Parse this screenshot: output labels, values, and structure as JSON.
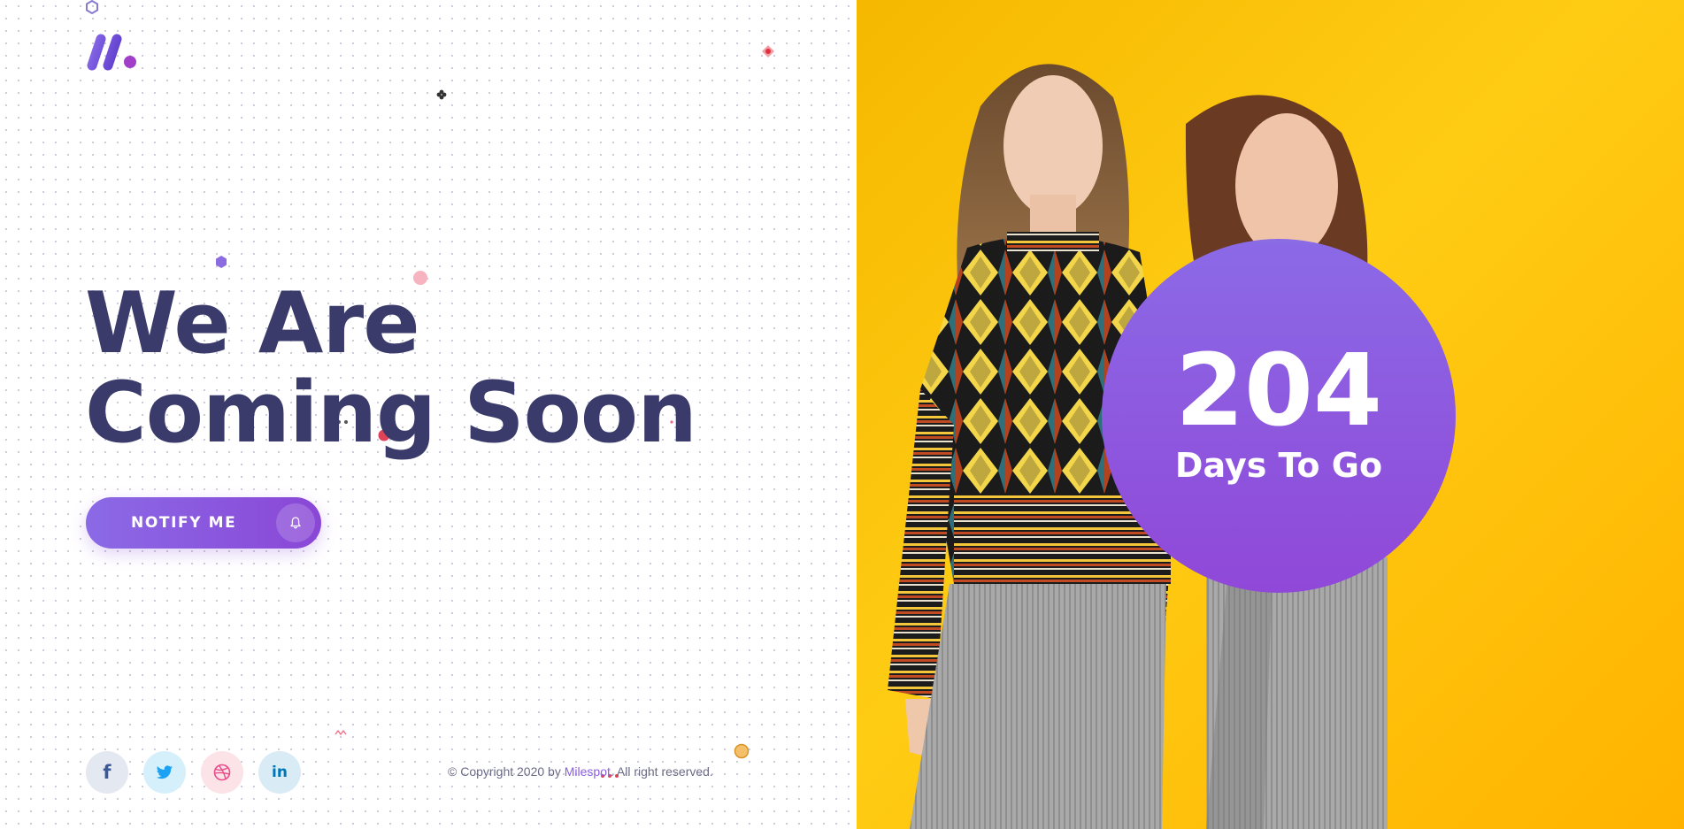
{
  "brand": {
    "logo_icon": "milespot-logo-icon"
  },
  "hero": {
    "headline_line1": "We Are",
    "headline_line2": "Coming Soon"
  },
  "notify": {
    "label": "NOTIFY ME",
    "icon": "bell-icon"
  },
  "countdown": {
    "value": "204",
    "label": "Days To Go"
  },
  "socials": [
    {
      "name": "facebook",
      "icon": "facebook-icon",
      "glyph": "f"
    },
    {
      "name": "twitter",
      "icon": "twitter-icon"
    },
    {
      "name": "dribbble",
      "icon": "dribbble-icon"
    },
    {
      "name": "linkedin",
      "icon": "linkedin-icon",
      "glyph": "in"
    }
  ],
  "footer": {
    "copyright_prefix": "© Copyright 2020 by ",
    "brand_link": "Milespot",
    "copyright_suffix": ". All right reserved."
  },
  "colors": {
    "heading": "#3b3b6b",
    "accent_start": "#8b6ae6",
    "accent_end": "#8a47d6",
    "photo_background": "#ffc107"
  }
}
